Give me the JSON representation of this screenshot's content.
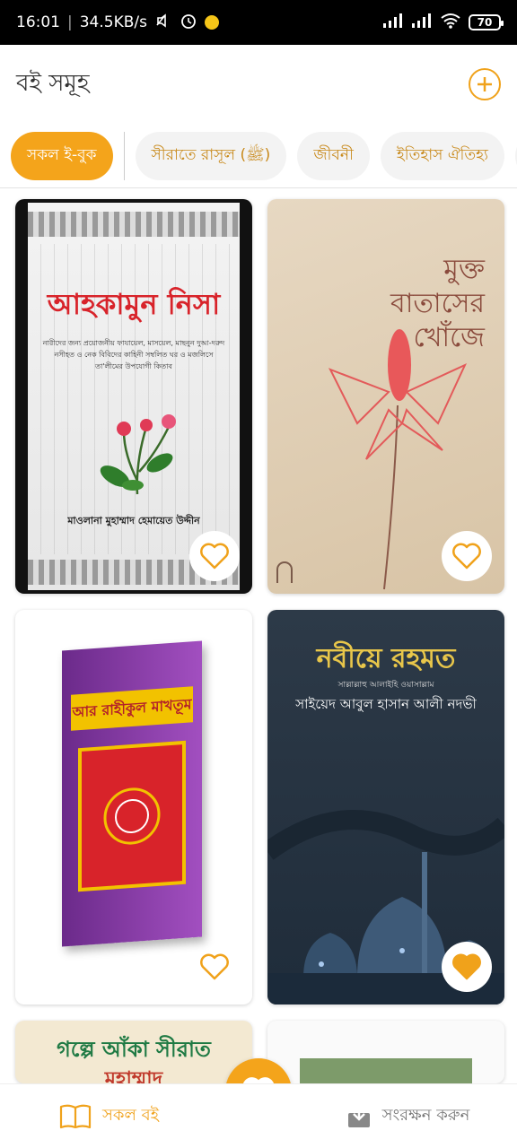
{
  "status_bar": {
    "time": "16:01",
    "speed": "34.5KB/s",
    "battery": "70"
  },
  "header": {
    "title": "বই সমূহ",
    "add_icon": "plus-circle-icon"
  },
  "categories": [
    {
      "label": "সকল ই-বুক",
      "active": true
    },
    {
      "label": "সীরাতে রাসূল (ﷺ)",
      "active": false
    },
    {
      "label": "জীবনী",
      "active": false
    },
    {
      "label": "ইতিহাস ঐতিহ্য",
      "active": false
    }
  ],
  "books": [
    {
      "title": "আহকামুন নিসা",
      "subtitle": "নারীদের জন্য প্রয়োজনীয় ফাযায়েল, মাসয়েল, মাছনুন দুআ-দরুদ নসীহত ও নেক বিবিদের কাহিনী সম্বলিত ঘর ও মজলিসে তা'লীমের উপযোগী কিতাব",
      "author": "মাওলানা মুহাম্মাদ হেমায়েত উদ্দীন",
      "favorited": false
    },
    {
      "title": "মুক্ত বাতাসের খোঁজে",
      "favorited": false
    },
    {
      "title": "আর রাহীকুল মাখতূম",
      "favorited": false
    },
    {
      "title": "নবীয়ে রহমত",
      "subtitle": "সাল্লাল্লাহু আলাইহি ওয়াসাল্লাম",
      "author": "সাইয়েদ আবুল হাসান আলী নদভী",
      "favorited": true
    },
    {
      "title": "গল্পে আঁকা সীরাত",
      "subtitle": "মুহাম্মাদ",
      "favorited": false
    },
    {
      "title": "",
      "favorited": false
    }
  ],
  "bottom_nav": {
    "all_books": "সকল বই",
    "save": "সংরক্ষন করুন"
  },
  "colors": {
    "accent": "#f4a41b"
  }
}
